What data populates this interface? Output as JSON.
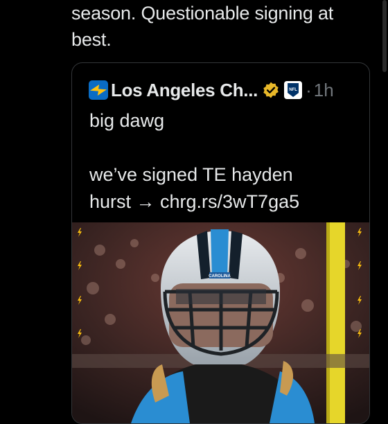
{
  "tweet": {
    "text": "season. Questionable signing at\nbest."
  },
  "quote": {
    "account_name": "Los Angeles Ch...",
    "separator": "·",
    "time": "1h",
    "text": "big dawg\n\nwe’ve signed TE hayden\nhurst → chrg.rs/3wT7ga5",
    "verified_color": "#e8b829",
    "avatar_color": "#0a6cc4",
    "bolt_color": "#ffc20e",
    "affiliate_badge": "NFL",
    "helmet_text": "CAROLINA"
  },
  "icons": [
    "chargers-logo-icon",
    "verified-gold-icon",
    "nfl-shield-icon",
    "lightning-bolt-icon"
  ]
}
